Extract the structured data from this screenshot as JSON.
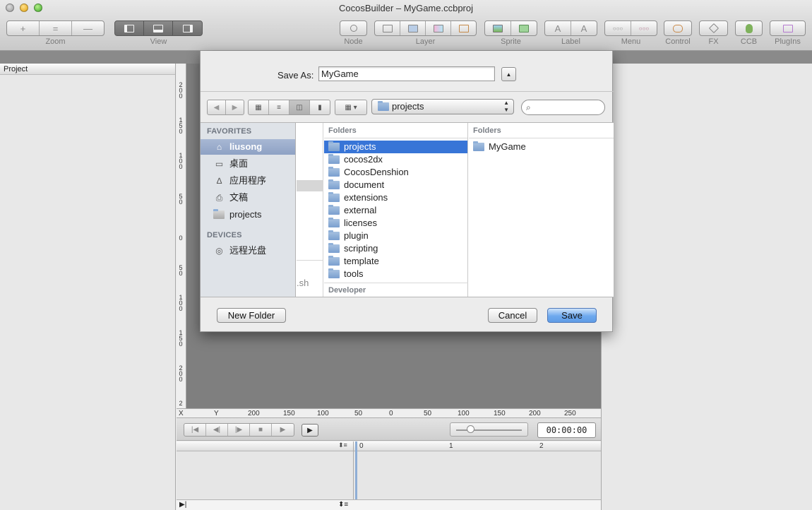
{
  "window": {
    "title": "CocosBuilder – MyGame.ccbproj"
  },
  "toolbar": {
    "groups": [
      {
        "label": "Zoom"
      },
      {
        "label": "View"
      },
      {
        "label": "Node"
      },
      {
        "label": "Layer"
      },
      {
        "label": "Sprite"
      },
      {
        "label": "Label"
      },
      {
        "label": "Menu"
      },
      {
        "label": "Control"
      },
      {
        "label": "FX"
      },
      {
        "label": "CCB"
      },
      {
        "label": "PlugIns"
      }
    ],
    "icons": {
      "zoom": [
        "zoom-in-icon",
        "zoom-reset-icon",
        "zoom-out-icon"
      ],
      "view": [
        "view-left-panel-icon",
        "view-bottom-panel-icon",
        "view-right-panel-icon"
      ]
    },
    "glyphs": {
      "zoom_in": "+",
      "zoom_reset": "=",
      "zoom_out": "—",
      "label_a": "A",
      "menu_ooo": "○○○"
    }
  },
  "project_panel": {
    "title": "Project"
  },
  "rulers": {
    "vertical": [
      "2",
      "0",
      "0",
      "1",
      "5",
      "0",
      "1",
      "0",
      "0",
      "5",
      "0",
      "0",
      "5",
      "0",
      "1",
      "0",
      "0",
      "1",
      "5",
      "0",
      "2",
      "0",
      "0",
      "2"
    ],
    "horizontal": [
      "X",
      "Y",
      "200",
      "150",
      "100",
      "50",
      "0",
      "50",
      "100",
      "150",
      "200",
      "250"
    ]
  },
  "timeline": {
    "time": "00:00:00",
    "ruler": [
      "0",
      "1",
      "2"
    ],
    "glyphs": {
      "first": "|◀",
      "prev": "◀|",
      "next": "|▶",
      "stop": "■",
      "play": "▶",
      "play_box": "▶",
      "sort": "⬍≡",
      "expand": "▶|"
    }
  },
  "save_sheet": {
    "save_as_label": "Save As:",
    "filename": "MyGame",
    "expand_glyph": "▲",
    "back_glyph": "◀",
    "forward_glyph": "▶",
    "view_modes": [
      "icon-view-icon",
      "list-view-icon",
      "column-view-icon",
      "coverflow-view-icon"
    ],
    "active_view_mode": "column-view-icon",
    "path_popup": "projects",
    "arrange_glyph": "▦ ▾",
    "search_glyph": "⌕",
    "sidebar": {
      "favorites_header": "FAVORITES",
      "favorites": [
        {
          "label": "liusong",
          "icon": "home-icon",
          "glyph": "⌂",
          "selected": true
        },
        {
          "label": "桌面",
          "icon": "desktop-icon",
          "glyph": "▭"
        },
        {
          "label": "应用程序",
          "icon": "applications-icon",
          "glyph": "∆"
        },
        {
          "label": "文稿",
          "icon": "documents-icon",
          "glyph": "⎙"
        },
        {
          "label": "projects",
          "icon": "folder-icon",
          "glyph": ""
        }
      ],
      "devices_header": "DEVICES",
      "devices": [
        {
          "label": "远程光盘",
          "icon": "remote-disc-icon",
          "glyph": "◎"
        }
      ]
    },
    "partial_column_text": ".sh",
    "column1": {
      "header": "Folders",
      "items": [
        "projects",
        "cocos2dx",
        "CocosDenshion",
        "document",
        "extensions",
        "external",
        "licenses",
        "plugin",
        "scripting",
        "template",
        "tools"
      ],
      "selected": "projects",
      "footer": "Developer"
    },
    "column2": {
      "header": "Folders",
      "items": [
        "MyGame"
      ]
    },
    "new_folder_button": "New Folder",
    "cancel_button": "Cancel",
    "save_button": "Save"
  }
}
